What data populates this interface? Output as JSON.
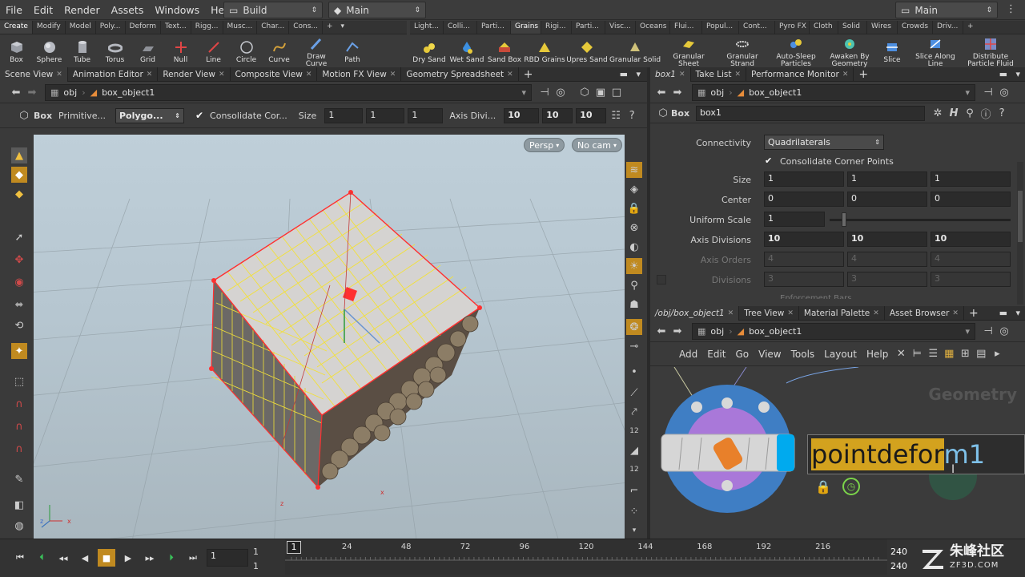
{
  "menu": [
    "File",
    "Edit",
    "Render",
    "Assets",
    "Windows",
    "Help"
  ],
  "desktop": {
    "left_label": "Build",
    "right_label": "Main",
    "center_label": "Main"
  },
  "shelf_left": {
    "tabs": [
      "Create",
      "Modify",
      "Model",
      "Poly...",
      "Deform",
      "Text...",
      "Rigg...",
      "Musc...",
      "Char...",
      "Cons..."
    ],
    "tools": [
      "Box",
      "Sphere",
      "Tube",
      "Torus",
      "Grid",
      "Null",
      "Line",
      "Circle",
      "Curve",
      "Draw Curve",
      "Path"
    ]
  },
  "shelf_right": {
    "tabs": [
      "Light...",
      "Colli...",
      "Parti...",
      "Grains",
      "Rigi...",
      "Parti...",
      "Visc...",
      "Oceans",
      "Flui...",
      "Popul...",
      "Cont...",
      "Pyro FX",
      "Cloth",
      "Solid",
      "Wires",
      "Crowds",
      "Driv..."
    ],
    "tools": [
      "Dry Sand",
      "Wet Sand",
      "Sand Box",
      "RBD Grains",
      "Upres Sand",
      "Granular Solid",
      "Granular Sheet",
      "Granular Strand",
      "Auto-Sleep Particles",
      "Awaken By Geometry",
      "Slice",
      "Slice Along Line",
      "Distribute Particle Fluid"
    ]
  },
  "viewer": {
    "tabs": [
      "Scene View",
      "Animation Editor",
      "Render View",
      "Composite View",
      "Motion FX View",
      "Geometry Spreadsheet"
    ],
    "path_root": "obj",
    "path_node": "box_object1",
    "op_label": "Box",
    "op_type": "Primitive...",
    "op_mode": "Polygo...",
    "consolidate_label": "Consolidate Cor...",
    "size_label": "Size",
    "size": [
      "1",
      "1",
      "1"
    ],
    "axisdiv_label": "Axis Divi...",
    "axisdiv": [
      "10",
      "10",
      "10"
    ],
    "persp": "Persp",
    "cam": "No cam",
    "ruler_labels": [
      "x",
      "z",
      "z",
      "x"
    ]
  },
  "params": {
    "tabs": [
      "box1",
      "Take List",
      "Performance Monitor"
    ],
    "path_root": "obj",
    "path_node": "box_object1",
    "node_type": "Box",
    "node_name": "box1",
    "connectivity_label": "Connectivity",
    "connectivity_value": "Quadrilaterals",
    "consolidate_label": "Consolidate Corner Points",
    "size_label": "Size",
    "size": [
      "1",
      "1",
      "1"
    ],
    "center_label": "Center",
    "center": [
      "0",
      "0",
      "0"
    ],
    "uniform_scale_label": "Uniform Scale",
    "uniform_scale": "1",
    "uniform_scale_fraction": 0.08,
    "axisdiv_label": "Axis Divisions",
    "axisdiv": [
      "10",
      "10",
      "10"
    ],
    "axis_orders_label": "Axis Orders",
    "axis_orders": [
      "4",
      "4",
      "4"
    ],
    "divisions_label": "Divisions",
    "divisions": [
      "3",
      "3",
      "3"
    ],
    "enforcement_label": "Enforcement Bars"
  },
  "network": {
    "tabs": [
      "/obj/box_object1",
      "Tree View",
      "Material Palette",
      "Asset Browser"
    ],
    "path_root": "obj",
    "path_node": "box_object1",
    "menu": [
      "Add",
      "Edit",
      "Go",
      "View",
      "Tools",
      "Layout",
      "Help"
    ],
    "context_label": "Geometry",
    "new_node_name_selected": "pointdefor",
    "new_node_name_rest": "m1"
  },
  "timeline": {
    "frame": "1",
    "start": "1",
    "start2": "1",
    "cur_marker": "1",
    "ticks": [
      "24",
      "48",
      "72",
      "96",
      "120",
      "144",
      "168",
      "192",
      "216"
    ],
    "end": "240",
    "end2": "240"
  },
  "watermark": {
    "cn": "朱峰社区",
    "url": "ZF3D.COM"
  },
  "colors": {
    "accent": "#d3a21e",
    "node_blue": "#3f7ec4",
    "node_purple": "#a978d9",
    "cube_wire": "#f2e03a",
    "cube_edge": "#ff3030"
  }
}
